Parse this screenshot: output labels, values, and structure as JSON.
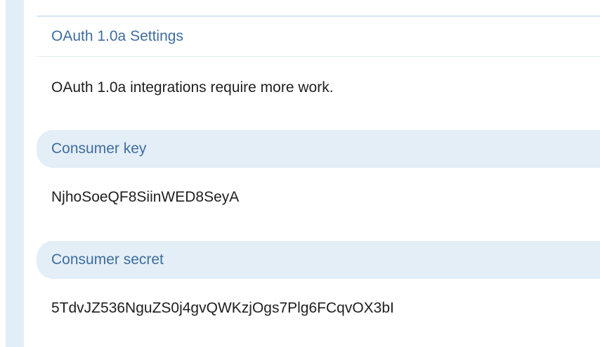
{
  "settings": {
    "title": "OAuth 1.0a Settings",
    "description": "OAuth 1.0a integrations require more work.",
    "consumer_key": {
      "label": "Consumer key",
      "value": "NjhoSoeQF8SiinWED8SeyA"
    },
    "consumer_secret": {
      "label": "Consumer secret",
      "value": "5TdvJZ536NguZS0j4gvQWKzjOgs7Plg6FCqvOX3bI"
    }
  }
}
